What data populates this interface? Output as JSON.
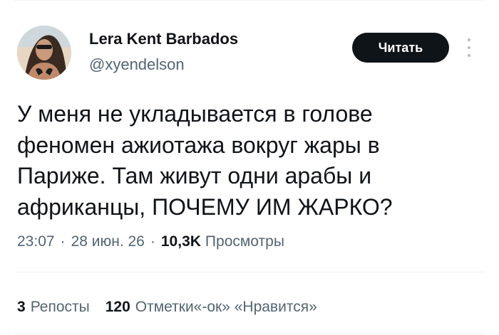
{
  "author": {
    "display_name": "Lera Kent Barbados",
    "handle": "@xyendelson"
  },
  "follow_button": {
    "label": "Читать"
  },
  "tweet": {
    "lines": [
      "У меня не укладывается в голове",
      "феномен ажиотажа вокруг жары в",
      "Париже. Там живут одни арабы и",
      "африканцы, ПОЧЕМУ ИМ ЖАРКО?"
    ]
  },
  "meta": {
    "time": "23:07",
    "date": "28 июн. 26",
    "separator": "·",
    "views_count": "10,3K",
    "views_label": "Просмотры"
  },
  "stats": {
    "reposts_count": "3",
    "reposts_label": "Репосты",
    "likes_count": "120",
    "likes_label": "Отметки«-ок» «Нравится»"
  },
  "icons": {
    "more": "more-vertical-icon"
  },
  "colors": {
    "text": "#0f1419",
    "secondary": "#536471",
    "button_bg": "#0f1419",
    "button_text": "#ffffff",
    "divider": "#eff3f4"
  }
}
